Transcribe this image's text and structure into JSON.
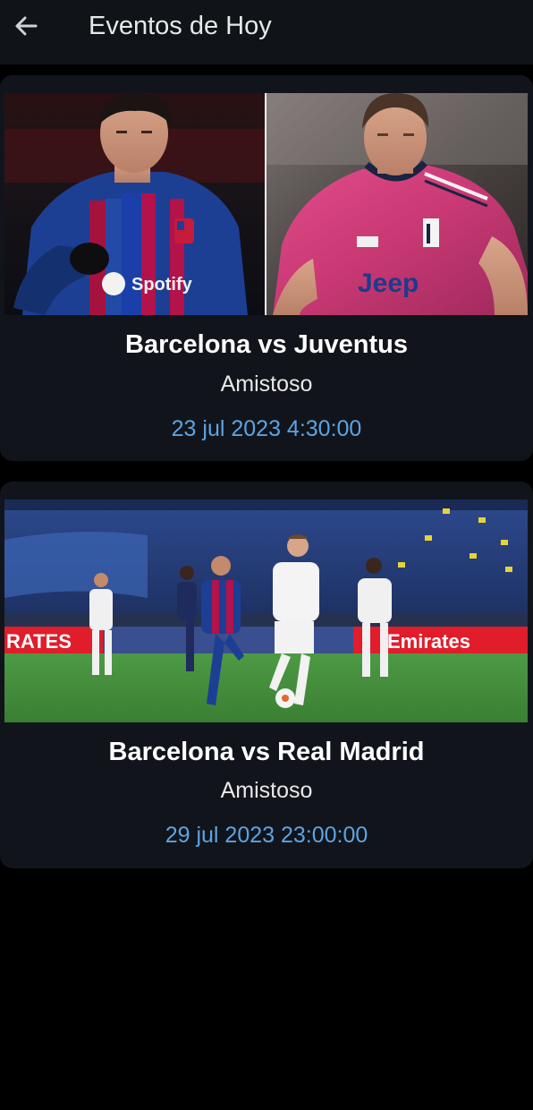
{
  "header": {
    "title": "Eventos de Hoy",
    "back_icon": "arrow-back-icon"
  },
  "events": [
    {
      "title": "Barcelona vs Juventus",
      "type": "Amistoso",
      "datetime": "23 jul 2023 4:30:00",
      "image_desc_icon": "players-photo"
    },
    {
      "title": "Barcelona vs Real Madrid",
      "type": "Amistoso",
      "datetime": "29 jul 2023 23:00:00",
      "image_desc_icon": "match-photo"
    }
  ],
  "colors": {
    "background": "#000000",
    "surface": "#11151b",
    "date_accent": "#5ea3e3",
    "barca_blue": "#1c3f94",
    "barca_red": "#b3124b",
    "juve_pink": "#d8427e",
    "pitch_green": "#3f8e38"
  }
}
